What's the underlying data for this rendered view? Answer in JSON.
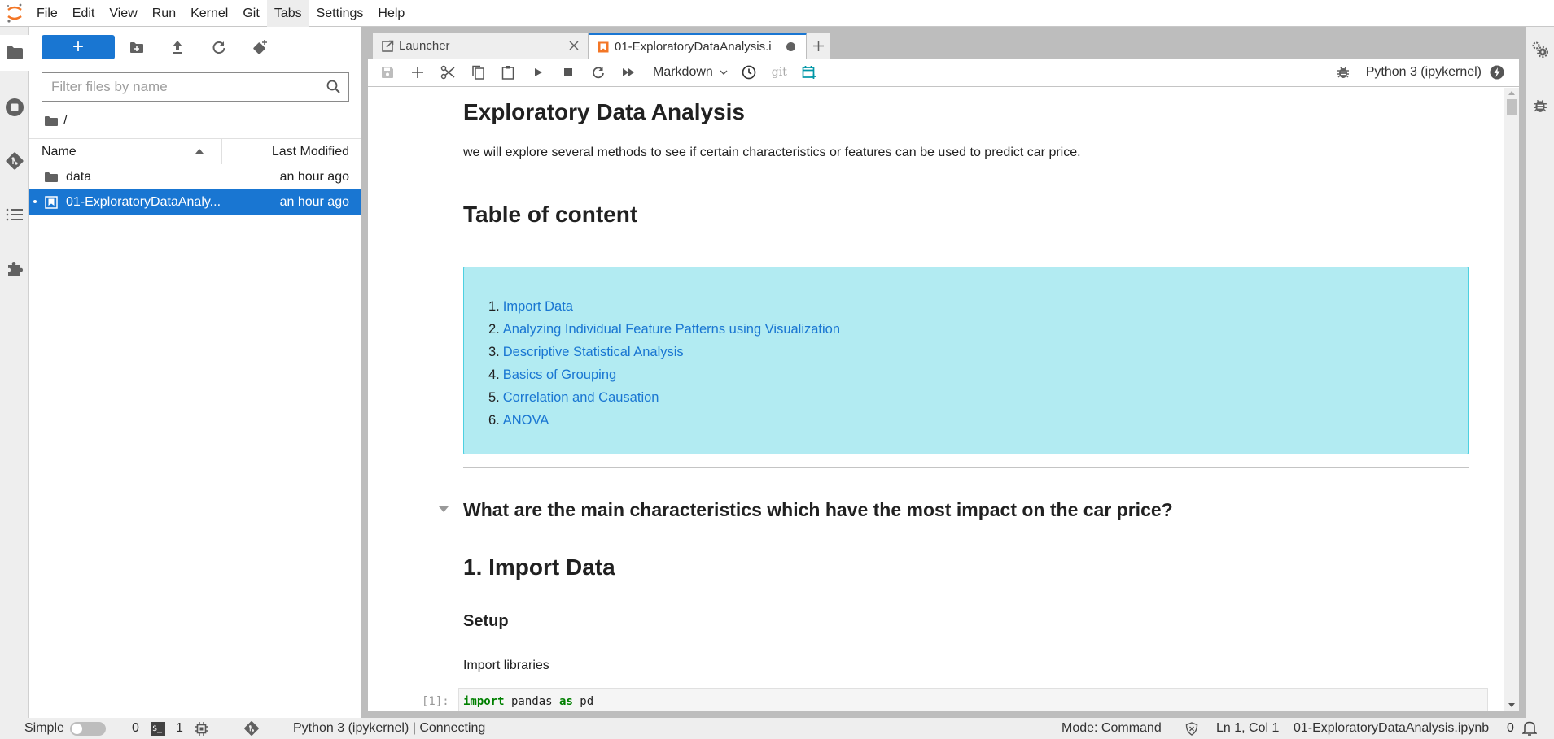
{
  "menubar": {
    "items": [
      "File",
      "Edit",
      "View",
      "Run",
      "Kernel",
      "Git",
      "Tabs",
      "Settings",
      "Help"
    ],
    "active_item": "Tabs"
  },
  "left_sidebar": {
    "icons": [
      "folder-icon",
      "running-icon",
      "git-icon",
      "toc-icon",
      "extension-icon"
    ]
  },
  "file_browser": {
    "new_button_label": "+",
    "filter_placeholder": "Filter files by name",
    "breadcrumb": "/",
    "columns": {
      "name": "Name",
      "modified": "Last Modified"
    },
    "files": [
      {
        "name": "data",
        "type": "folder",
        "modified": "an hour ago",
        "selected": false
      },
      {
        "name": "01-ExploratoryDataAnaly...",
        "type": "notebook",
        "modified": "an hour ago",
        "selected": true,
        "running": true
      }
    ]
  },
  "tabs": [
    {
      "label": "Launcher",
      "icon": "launcher-icon",
      "active": false,
      "closable": true
    },
    {
      "label": "01-ExploratoryDataAnalysis.i",
      "icon": "notebook-icon",
      "active": true,
      "dirty": true
    }
  ],
  "notebook_toolbar": {
    "cell_type": "Markdown",
    "git_label": "git",
    "kernel_name": "Python 3 (ipykernel)"
  },
  "notebook": {
    "title": "Exploratory Data Analysis",
    "intro": "we will explore several methods to see if certain characteristics or features can be used to predict car price.",
    "toc_heading": "Table of content",
    "toc": [
      {
        "num": "1.",
        "label": "Import Data"
      },
      {
        "num": "2.",
        "label": "Analyzing Individual Feature Patterns using Visualization"
      },
      {
        "num": "3.",
        "label": "Descriptive Statistical Analysis"
      },
      {
        "num": "4.",
        "label": "Basics of Grouping"
      },
      {
        "num": "5.",
        "label": "Correlation and Causation"
      },
      {
        "num": "6.",
        "label": "ANOVA"
      }
    ],
    "question": "What are the main characteristics which have the most impact on the car price?",
    "section1": "1. Import Data",
    "setup": "Setup",
    "import_libs": "Import libraries",
    "code_cell": {
      "prompt": "[1]:",
      "kw1": "import",
      "mod": " pandas ",
      "kw2": "as",
      "alias": " pd"
    }
  },
  "statusbar": {
    "mode_label": "Simple",
    "terminals_count": "0",
    "kernels_count": "1",
    "kernel_status": "Python 3 (ipykernel) | Connecting",
    "command_mode": "Mode: Command",
    "cursor": "Ln 1, Col 1",
    "filename": "01-ExploratoryDataAnalysis.ipynb",
    "notifications": "0"
  },
  "colors": {
    "accent": "#1976d2",
    "toc_bg": "#b2ebf2",
    "toc_border": "#4dd0e1",
    "notebook_icon": "#f37626",
    "keyword": "#008000"
  }
}
